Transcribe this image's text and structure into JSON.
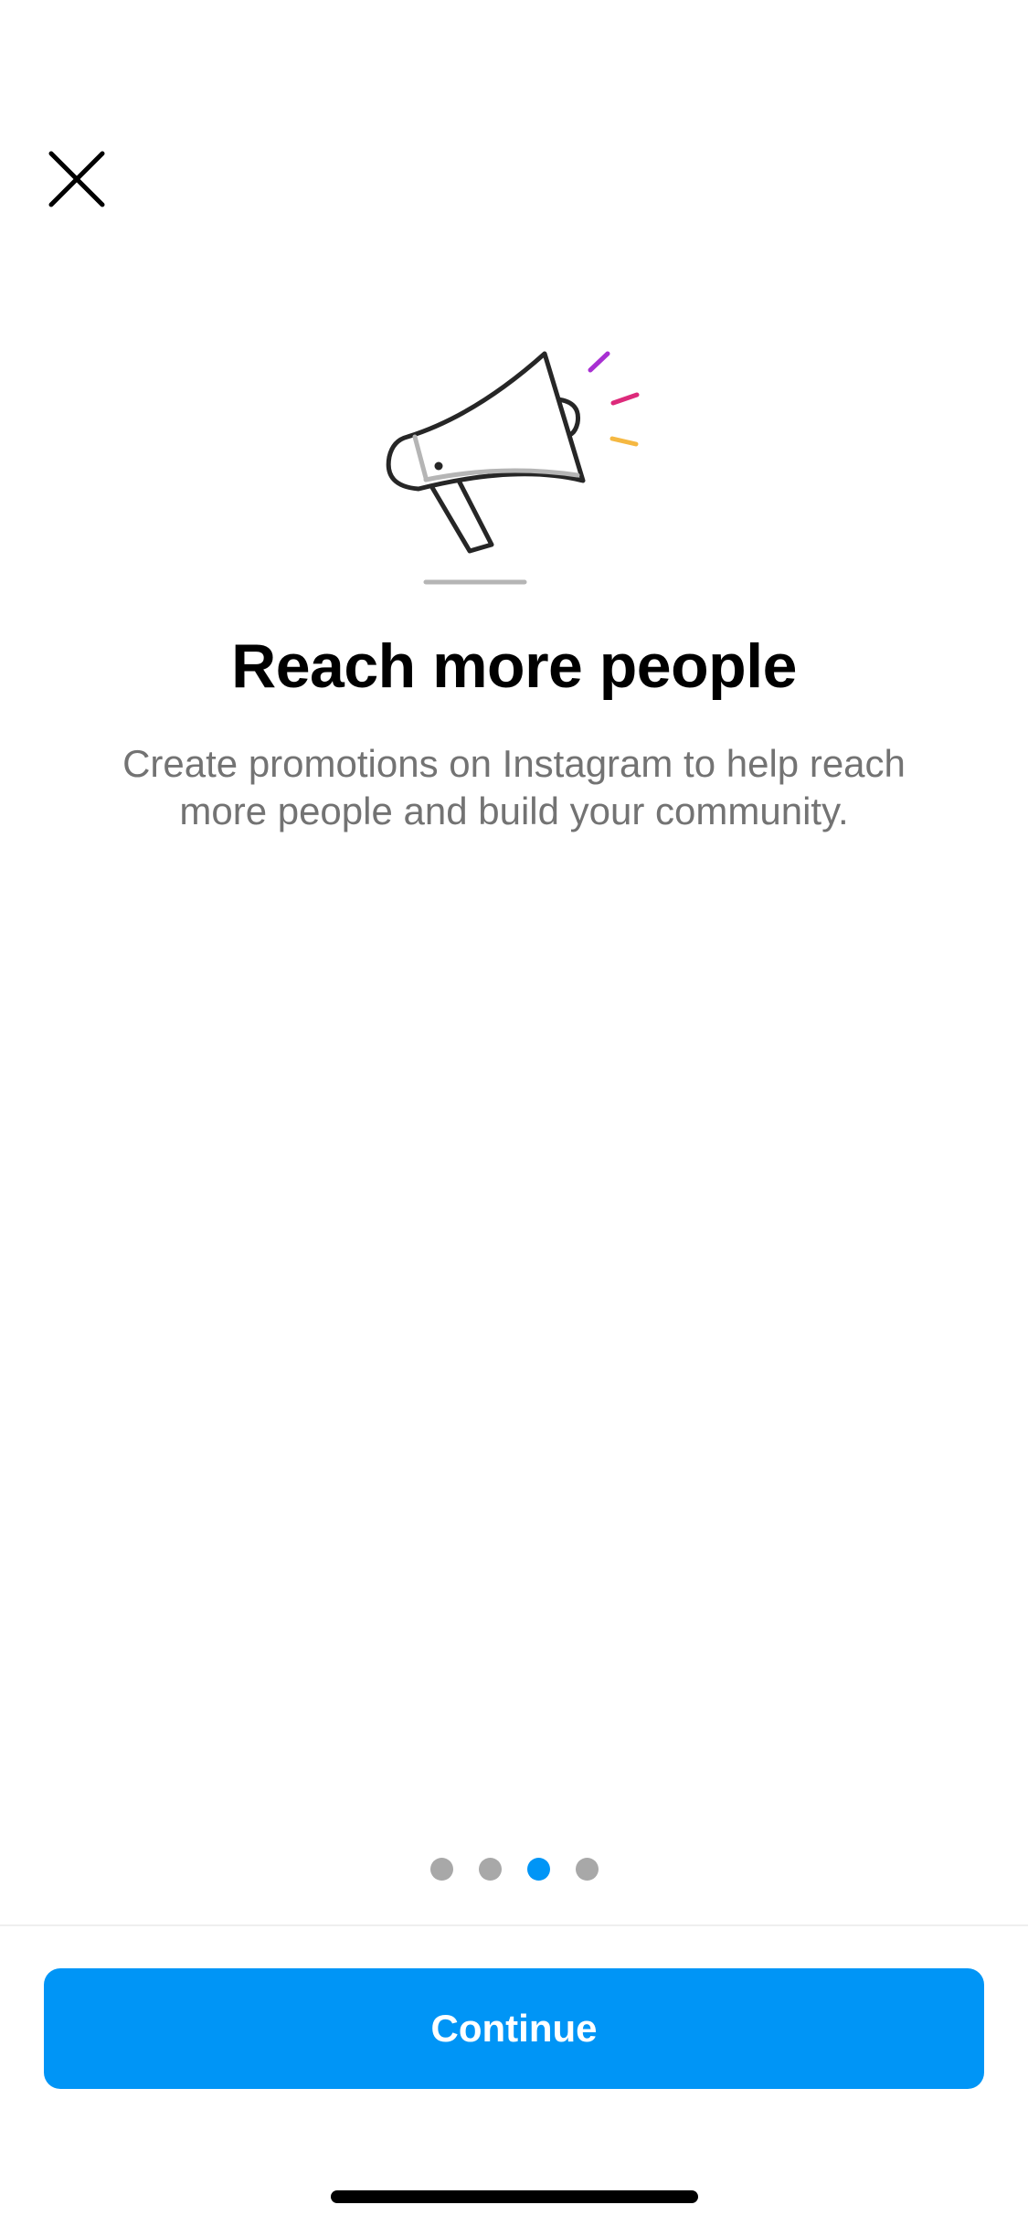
{
  "header": {
    "close_icon": "close-icon"
  },
  "illustration": {
    "icon": "megaphone-icon",
    "accent_colors": [
      "#a82fd2",
      "#dd2a7b",
      "#f5b842"
    ]
  },
  "content": {
    "title": "Reach more people",
    "subtitle": "Create promotions on Instagram to help reach more people and build your community."
  },
  "pagination": {
    "total": 4,
    "active_index": 2
  },
  "footer": {
    "continue_label": "Continue"
  },
  "colors": {
    "primary": "#0095f6",
    "dot_inactive": "#a8a8a8",
    "subtitle_text": "#737373"
  }
}
